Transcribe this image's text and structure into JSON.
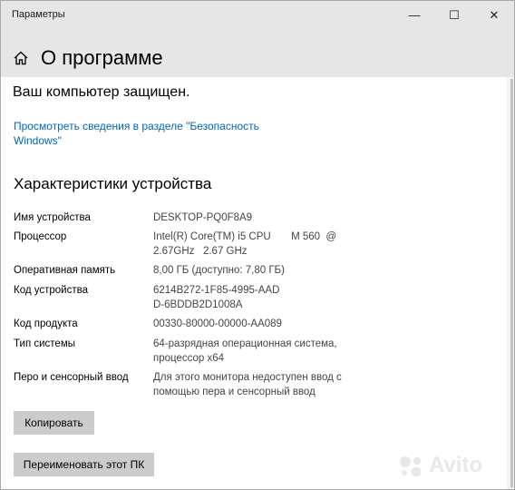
{
  "window": {
    "title": "Параметры",
    "controls": {
      "minimize": "—",
      "maximize": "☐",
      "close": "✕"
    }
  },
  "header": {
    "title": "О программе",
    "home_icon": "home-icon"
  },
  "content": {
    "protected_text": "Ваш компьютер защищен.",
    "security_link": "Просмотреть сведения в разделе \"Безопасность Windows\"",
    "section_title": "Характеристики устройства",
    "specs": [
      {
        "label": "Имя устройства",
        "value": "DESKTOP-PQ0F8A9"
      },
      {
        "label": "Процессор",
        "value": "Intel(R) Core(TM) i5 CPU       M 560  @ 2.67GHz   2.67 GHz"
      },
      {
        "label": "Оперативная память",
        "value": "8,00 ГБ (доступно: 7,80 ГБ)"
      },
      {
        "label": "Код устройства",
        "value": "6214B272-1F85-4995-AADD-6BDDB2D1008A"
      },
      {
        "label": "Код продукта",
        "value": "00330-80000-00000-AA089"
      },
      {
        "label": "Тип системы",
        "value": "64-разрядная операционная система, процессор x64"
      },
      {
        "label": "Перо и сенсорный ввод",
        "value": "Для этого монитора недоступен ввод с помощью пера и сенсорный ввод"
      }
    ],
    "copy_button": "Копировать",
    "rename_button": "Переименовать этот ПК"
  },
  "watermark": {
    "text": "Avito"
  },
  "colors": {
    "link": "#0067b8",
    "header_bg": "#e6e6e6",
    "button_bg": "#cccccc"
  }
}
